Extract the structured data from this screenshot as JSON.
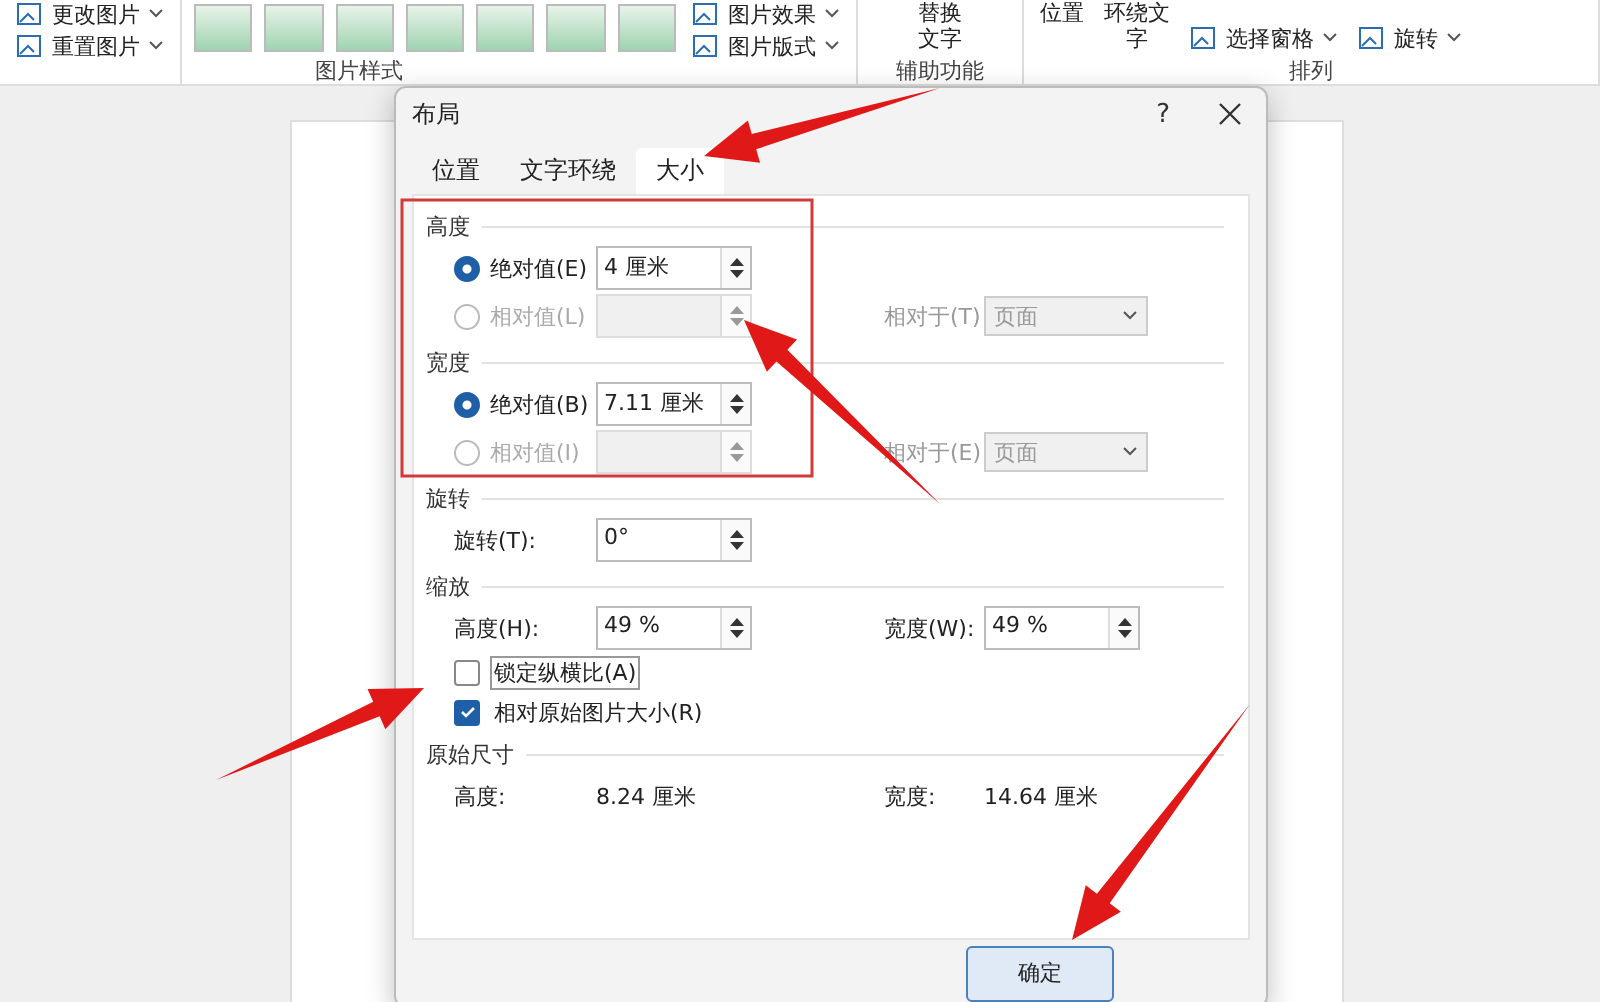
{
  "ribbon": {
    "left_buttons": [
      {
        "label": "更改图片"
      },
      {
        "label": "重置图片"
      }
    ],
    "style_group": {
      "label": "图片样式"
    },
    "style_buttons": [
      {
        "label": "图片效果"
      },
      {
        "label": "图片版式"
      }
    ],
    "accessibility": {
      "label": "辅助功能",
      "button": [
        "替换",
        "文字"
      ]
    },
    "arrange": {
      "label": "排列",
      "buttons": [
        {
          "label": [
            "位置"
          ],
          "kind": "large"
        },
        {
          "label": [
            "环绕文",
            "字"
          ],
          "kind": "large"
        },
        {
          "label": "选择窗格",
          "kind": "small"
        },
        {
          "label": "旋转",
          "kind": "small"
        }
      ]
    }
  },
  "dialog": {
    "title": "布局",
    "help": "?",
    "tabs": [
      {
        "label": "位置",
        "selected": false
      },
      {
        "label": "文字环绕",
        "selected": false
      },
      {
        "label": "大小",
        "selected": true
      }
    ],
    "height": {
      "title": "高度",
      "rows": [
        {
          "label": "绝对值(E)",
          "selected": true,
          "disabled": false,
          "value": "4 厘米"
        },
        {
          "label": "相对值(L)",
          "selected": false,
          "disabled": true,
          "value": "",
          "relative_label": "相对于(T)",
          "relative_value": "页面"
        }
      ]
    },
    "width": {
      "title": "宽度",
      "rows": [
        {
          "label": "绝对值(B)",
          "selected": true,
          "disabled": false,
          "value": "7.11 厘米"
        },
        {
          "label": "相对值(I)",
          "selected": false,
          "disabled": true,
          "value": "",
          "relative_label": "相对于(E)",
          "relative_value": "页面"
        }
      ]
    },
    "rotation": {
      "title": "旋转",
      "label": "旋转(T):",
      "value": "0°"
    },
    "scale": {
      "title": "缩放",
      "height_label": "高度(H):",
      "height_value": "49 %",
      "width_label": "宽度(W):",
      "width_value": "49 %",
      "checks": [
        {
          "label": "锁定纵横比(A)",
          "checked": false
        },
        {
          "label": "相对原始图片大小(R)",
          "checked": true
        }
      ]
    },
    "original": {
      "title": "原始尺寸",
      "height_label": "高度:",
      "height_value": "8.24 厘米",
      "width_label": "宽度:",
      "width_value": "14.64 厘米"
    },
    "ok_button": "确定"
  },
  "annotations": [
    {
      "kind": "box"
    },
    {
      "kind": "arrow"
    },
    {
      "kind": "arrow"
    },
    {
      "kind": "arrow"
    },
    {
      "kind": "arrow"
    }
  ]
}
